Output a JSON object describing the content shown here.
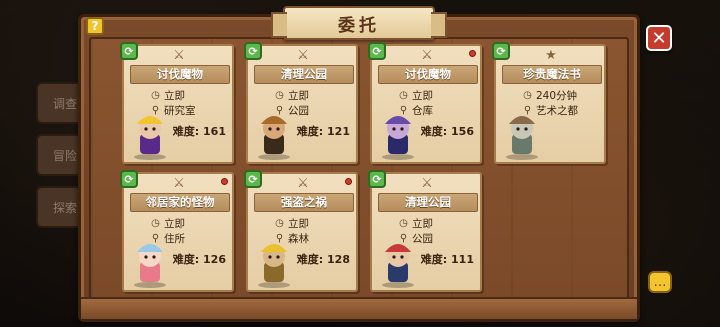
{
  "title": "委托",
  "side_tabs": [
    "调查",
    "冒险",
    "探索"
  ],
  "buttons": {
    "help": "?",
    "close": "✕",
    "chat": "…"
  },
  "difficulty_label": "难度:",
  "cards": [
    {
      "name": "讨伐魔物",
      "time": "立即",
      "place": "研究室",
      "difficulty": "161",
      "icon": "crossed-swords-icon",
      "pin": false
    },
    {
      "name": "清理公园",
      "time": "立即",
      "place": "公园",
      "difficulty": "121",
      "icon": "crossed-swords-icon",
      "pin": false
    },
    {
      "name": "讨伐魔物",
      "time": "立即",
      "place": "仓库",
      "difficulty": "156",
      "icon": "crossed-swords-icon",
      "pin": true
    },
    {
      "name": "珍贵魔法书",
      "time": "240分钟",
      "place": "艺术之都",
      "difficulty": "",
      "icon": "star-scroll-icon",
      "pin": false
    },
    {
      "name": "邻居家的怪物",
      "time": "立即",
      "place": "住所",
      "difficulty": "126",
      "icon": "crossed-swords-icon",
      "pin": true
    },
    {
      "name": "强盗之祸",
      "time": "立即",
      "place": "森林",
      "difficulty": "128",
      "icon": "crossed-swords-icon",
      "pin": true
    },
    {
      "name": "清理公园",
      "time": "立即",
      "place": "公园",
      "difficulty": "111",
      "icon": "crossed-swords-icon",
      "pin": false
    }
  ],
  "colors": {
    "board": "#7a4a2a",
    "card": "#f1dfbf",
    "refresh": "#5cb84a",
    "close": "#c63b2c",
    "help": "#f2c530"
  }
}
